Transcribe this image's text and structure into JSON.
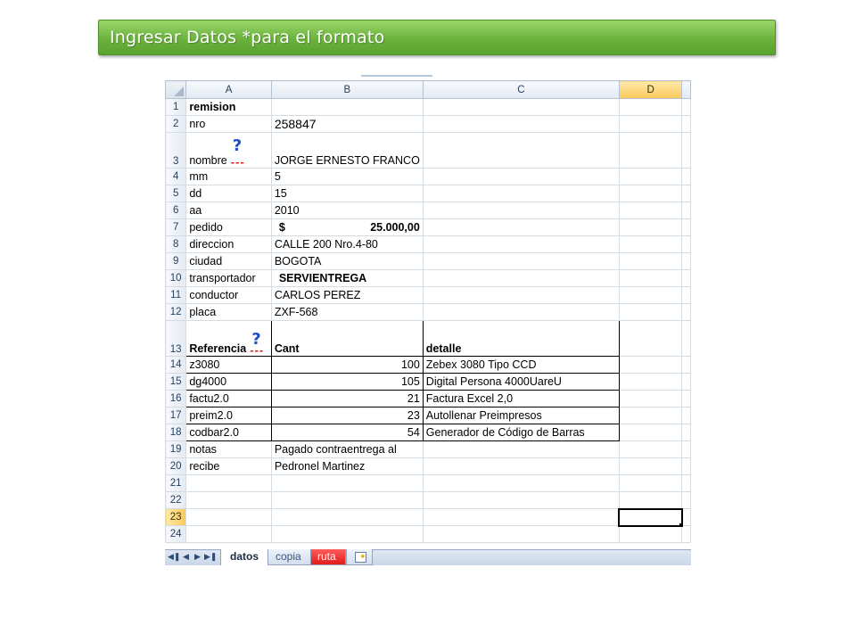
{
  "banner": {
    "title": "Ingresar Datos *para el formato"
  },
  "columns": [
    "A",
    "B",
    "C",
    "D"
  ],
  "rows": [
    {
      "n": "1",
      "a": "remision",
      "b": "",
      "c": ""
    },
    {
      "n": "2",
      "a": "nro",
      "b": "258847",
      "c": ""
    },
    {
      "n": "3",
      "a": "nombre",
      "b": "JORGE ERNESTO FRANCO",
      "c": ""
    },
    {
      "n": "4",
      "a": "mm",
      "b": "5",
      "c": ""
    },
    {
      "n": "5",
      "a": "dd",
      "b": "15",
      "c": ""
    },
    {
      "n": "6",
      "a": "aa",
      "b": "2010",
      "c": ""
    },
    {
      "n": "7",
      "a": "pedido",
      "b_currency": "$",
      "b": "25.000,00",
      "c": ""
    },
    {
      "n": "8",
      "a": "direccion",
      "b": "CALLE 200 Nro.4-80",
      "c": ""
    },
    {
      "n": "9",
      "a": "ciudad",
      "b": "BOGOTA",
      "c": ""
    },
    {
      "n": "10",
      "a": "transportador",
      "b": "SERVIENTREGA",
      "c": ""
    },
    {
      "n": "11",
      "a": "conductor",
      "b": "CARLOS PEREZ",
      "c": ""
    },
    {
      "n": "12",
      "a": "placa",
      "b": "ZXF-568",
      "c": ""
    },
    {
      "n": "13",
      "a": "Referencia",
      "b": "Cant",
      "c": "detalle"
    },
    {
      "n": "14",
      "a": "z3080",
      "b": "100",
      "c": "Zebex 3080 Tipo CCD"
    },
    {
      "n": "15",
      "a": "dg4000",
      "b": "105",
      "c": "Digital Persona 4000UareU"
    },
    {
      "n": "16",
      "a": "factu2.0",
      "b": "21",
      "c": "Factura Excel 2,0"
    },
    {
      "n": "17",
      "a": "preim2.0",
      "b": "23",
      "c": "Autollenar Preimpresos"
    },
    {
      "n": "18",
      "a": "codbar2.0",
      "b": "54",
      "c": "Generador de Código de Barras"
    },
    {
      "n": "19",
      "a": "notas",
      "b": "Pagado contraentrega al",
      "c": ""
    },
    {
      "n": "20",
      "a": "recibe",
      "b": "Pedronel Martinez",
      "c": ""
    },
    {
      "n": "21",
      "a": "",
      "b": "",
      "c": ""
    },
    {
      "n": "22",
      "a": "",
      "b": "",
      "c": ""
    },
    {
      "n": "23",
      "a": "",
      "b": "",
      "c": ""
    },
    {
      "n": "24",
      "a": "",
      "b": "",
      "c": ""
    }
  ],
  "annotations": {
    "question": "?",
    "dashes": "---"
  },
  "active_cell": "D23",
  "sheet_nav": [
    "first-sheet-icon",
    "prev-sheet-icon",
    "next-sheet-icon",
    "last-sheet-icon"
  ],
  "sheet_tabs": [
    "datos",
    "copia",
    "ruta"
  ],
  "colors": {
    "banner": "#6bb23d",
    "header_highlight": "#f9c85a",
    "tab_ruta": "#e31b1b",
    "annotation_q": "#1f4fc4",
    "annotation_dash": "#e01d1d"
  }
}
